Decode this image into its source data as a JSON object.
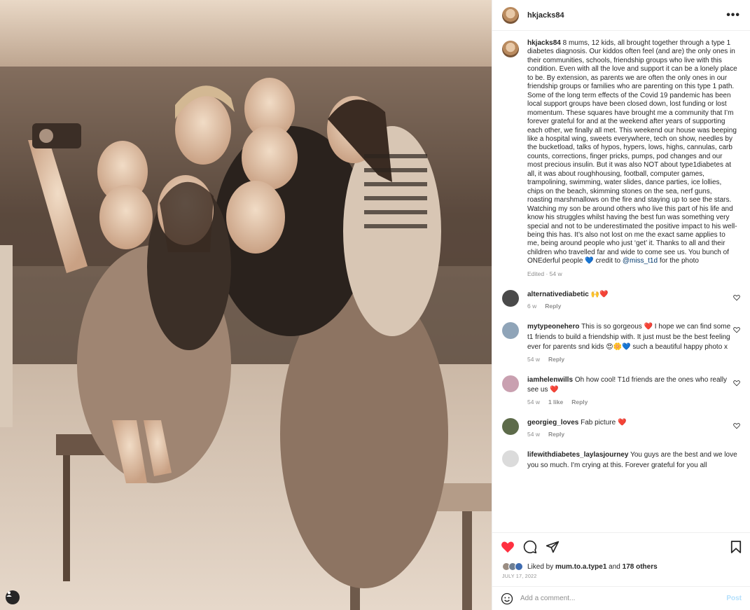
{
  "header": {
    "username": "hkjacks84",
    "more_label": "•••"
  },
  "caption": {
    "username": "hkjacks84",
    "text": "8 mums, 12 kids, all brought together through a type 1 diabetes diagnosis. Our kiddos often feel (and are) the only ones in their communities, schools, friendship groups who live with this condition. Even with all the love and support it can be a lonely place to be. By extension, as parents we are often the only ones in our friendship groups or families who are parenting on this type 1 path. Some of the long term effects of the Covid 19 pandemic has been local support groups have been closed down, lost funding or lost momentum. These squares have brought me a community that I’m forever grateful for and at the weekend after years of supporting each other, we finally all met. This weekend our house was beeping like a hospital wing, sweets everywhere, tech on show, needles by the bucketload, talks of hypos, hypers, lows, highs, cannulas, carb counts, corrections, finger pricks, pumps, pod changes and our most precious insulin. But it was also NOT about type1diabetes at all, it was about roughhousing, football, computer games, trampolining, swimming, water slides, dance parties, ice lollies, chips on the beach, skimming stones on the sea, nerf guns, roasting marshmallows on the fire and staying up to see the stars. Watching my son be around others who live this part of his life and know his struggles whilst having the best fun was something very special and not to be underestimated the positive impact to his well-being this has. It’s also not lost on me the exact same applies to me, being around people who just ‘get’ it. Thanks to all and their children who travelled far and wide to come see us. You bunch of ONEderful people",
    "emoji_blue_heart": "💙",
    "credit_text": "credit to",
    "mention": "@miss_t1d",
    "tail_text": "for the photo",
    "meta": "Edited · 54 w"
  },
  "comments": [
    {
      "username": "alternativediabetic",
      "text": "",
      "emoji": "🙌❤️",
      "time": "6 w",
      "likes": "",
      "reply": "Reply",
      "avatar_color": "#4a4a4a"
    },
    {
      "username": "mytypeonehero",
      "text": "This is so gorgeous ❤️ I hope we can find some t1 friends to build a friendship with. It just must be the best feeling ever for parents snd kids 😍🌼💙 such a beautiful happy photo x",
      "emoji": "",
      "time": "54 w",
      "likes": "",
      "reply": "Reply",
      "avatar_color": "#8fa4b8"
    },
    {
      "username": "iamhelenwills",
      "text": "Oh how cool! T1d friends are the ones who really see us ❤️",
      "emoji": "",
      "time": "54 w",
      "likes": "1 like",
      "reply": "Reply",
      "avatar_color": "#c9a0b0"
    },
    {
      "username": "georgieg_loves",
      "text": "Fab picture ❤️",
      "emoji": "",
      "time": "54 w",
      "likes": "",
      "reply": "Reply",
      "avatar_color": "#5d6b4a"
    },
    {
      "username": "lifewithdiabetes_laylasjourney",
      "text": "You guys are the best and we love you so much. I'm crying at this. Forever grateful for you all",
      "emoji": "",
      "time": "",
      "likes": "",
      "reply": "",
      "avatar_color": "#dbdbdb"
    }
  ],
  "likes": {
    "prefix": "Liked by",
    "user": "mum.to.a.type1",
    "and": "and",
    "others": "178 others"
  },
  "date": "JULY 17, 2022",
  "add_comment": {
    "placeholder": "Add a comment...",
    "post_label": "Post"
  },
  "icons": {
    "like": "heart-icon-filled",
    "comment": "comment-icon",
    "share": "share-icon",
    "save": "bookmark-icon",
    "emoji": "emoji-icon",
    "tag": "user-tag-icon",
    "more": "more-icon",
    "comment_like": "heart-outline-icon"
  },
  "colors": {
    "like_red": "#ff3040",
    "link_blue": "#00376b",
    "post_disabled": "#b2dffc",
    "meta_gray": "#8e8e8e"
  }
}
